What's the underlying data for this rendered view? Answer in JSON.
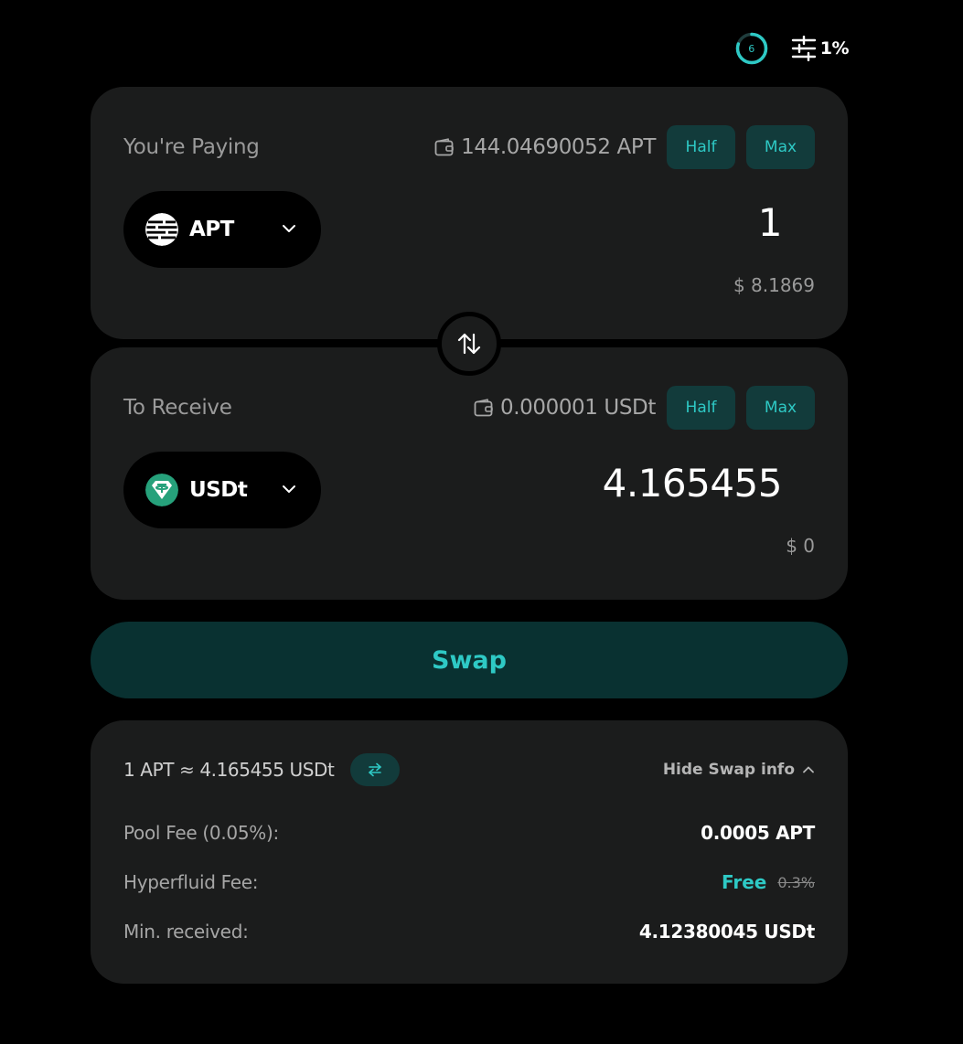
{
  "top": {
    "countdown": "6",
    "slippage": "1%"
  },
  "pay": {
    "label": "You're Paying",
    "balance": "144.04690052 APT",
    "half_label": "Half",
    "max_label": "Max",
    "token": "APT",
    "amount": "1",
    "usd": "$ 8.1869"
  },
  "receive": {
    "label": "To Receive",
    "balance": "0.000001 USDt",
    "half_label": "Half",
    "max_label": "Max",
    "token": "USDt",
    "amount": "4.165455",
    "usd": "$ 0"
  },
  "swap_label": "Swap",
  "info": {
    "rate": "1 APT ≈ 4.165455 USDt",
    "toggle_label": "Hide Swap info",
    "pool_fee_label": "Pool Fee (0.05%):",
    "pool_fee_value": "0.0005 APT",
    "hyperfluid_fee_label": "Hyperfluid Fee:",
    "hyperfluid_fee_free": "Free",
    "hyperfluid_fee_original": "0.3%",
    "min_received_label": "Min. received:",
    "min_received_value": "4.12380045 USDt"
  },
  "colors": {
    "accent": "#2ec9c5",
    "panel": "#1b1c1c",
    "chip": "#123b3b",
    "swap_bg": "#093131"
  }
}
